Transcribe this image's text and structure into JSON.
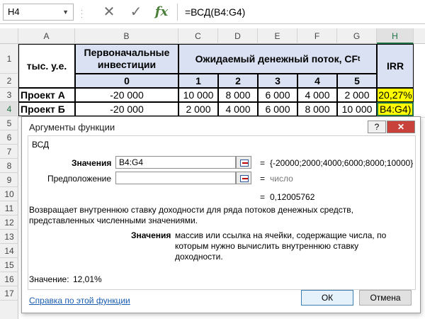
{
  "formula_bar": {
    "name_box": "H4",
    "cancel_icon": "✕",
    "enter_icon": "✓",
    "fx_label": "fx",
    "formula": "=ВСД(B4:G4)"
  },
  "columns": [
    "A",
    "B",
    "C",
    "D",
    "E",
    "F",
    "G",
    "H"
  ],
  "rows": [
    "1",
    "2",
    "3",
    "4",
    "5",
    "6",
    "7",
    "8",
    "9",
    "10",
    "11",
    "12",
    "13",
    "14",
    "15",
    "16",
    "17"
  ],
  "table": {
    "units": "тыс. у.е.",
    "initial_investment": "Первоначальные инвестиции",
    "cash_flow": "Ожидаемый денежный поток, CF",
    "cash_flow_sub": "t",
    "irr": "IRR",
    "periods": [
      "0",
      "1",
      "2",
      "3",
      "4",
      "5"
    ],
    "projects": [
      {
        "name": "Проект А",
        "values": [
          "-20 000",
          "10 000",
          "8 000",
          "6 000",
          "4 000",
          "2 000"
        ],
        "irr": "20,27%"
      },
      {
        "name": "Проект Б",
        "values": [
          "-20 000",
          "2 000",
          "4 000",
          "6 000",
          "8 000",
          "10 000"
        ],
        "irr": "B4:G4)"
      }
    ]
  },
  "dialog": {
    "title": "Аргументы функции",
    "help_icon": "?",
    "close_icon": "✕",
    "function_name": "ВСД",
    "arg1_label": "Значения",
    "arg1_value": "B4:G4",
    "arg1_result": "{-20000;2000;4000;6000;8000;10000}",
    "arg2_label": "Предположение",
    "arg2_value": "",
    "arg2_result": "число",
    "equals": "=",
    "formula_result": "0,12005762",
    "description": "Возвращает внутреннюю ставку доходности для ряда потоков денежных средств, представленных численными значениями.",
    "arg_help_name": "Значения",
    "arg_help_text": "массив или ссылка на ячейки, содержащие числа, по которым нужно вычислить внутреннюю ставку доходности.",
    "value_label": "Значение:",
    "value": "12,01%",
    "help_link": "Справка по этой функции",
    "ok": "ОК",
    "cancel": "Отмена"
  },
  "colors": {
    "header_fill": "#d9e1f2",
    "irr_fill": "#ffff00",
    "selection_green": "#217346",
    "close_red": "#c8413a"
  }
}
